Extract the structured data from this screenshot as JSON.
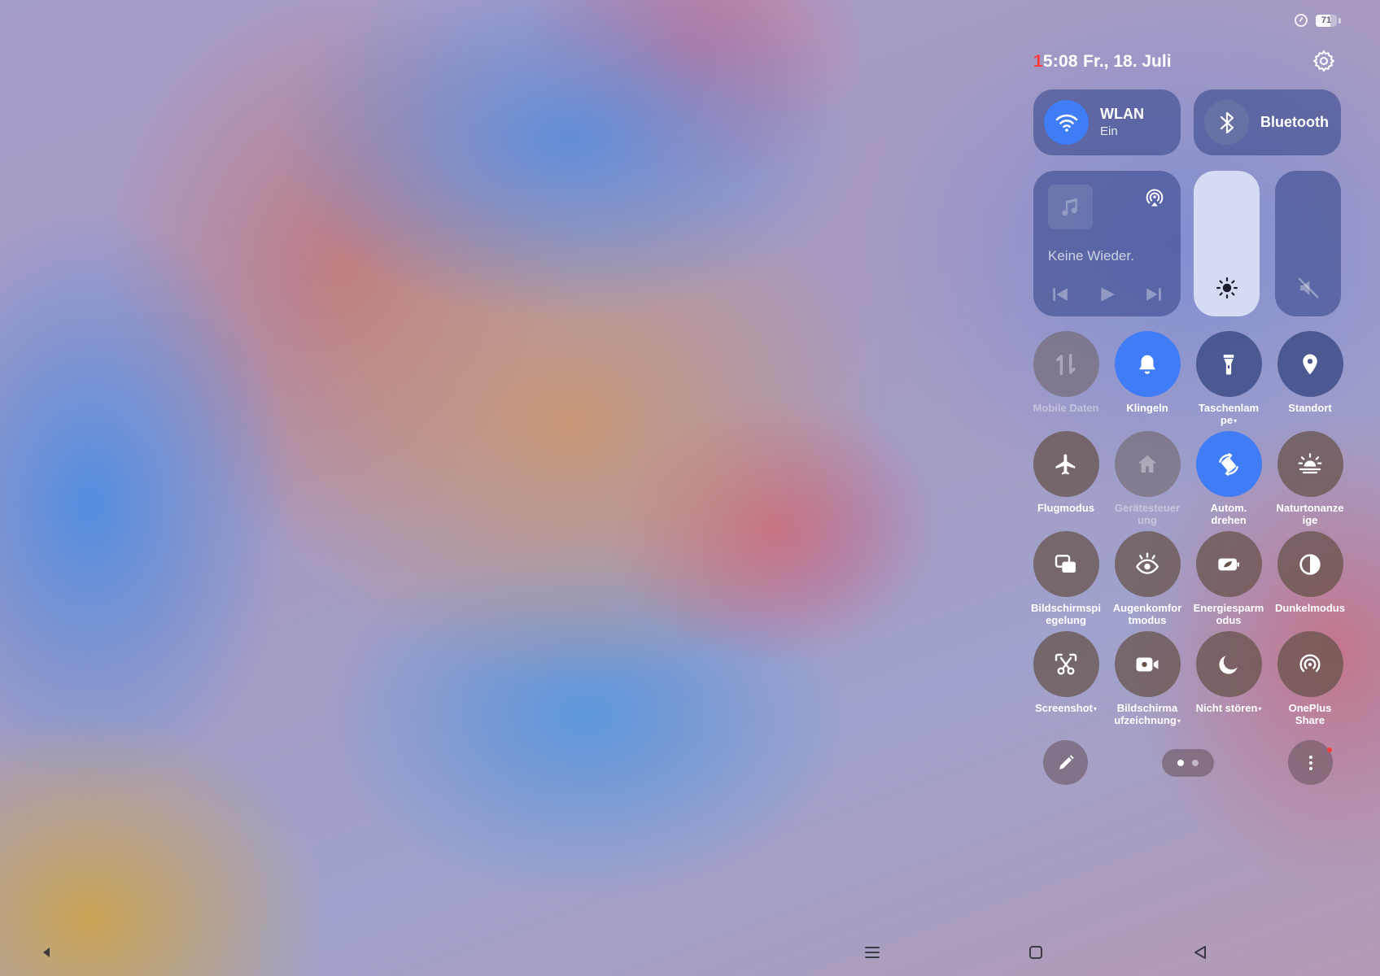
{
  "status_bar": {
    "battery": "71",
    "battery_level": 0.71
  },
  "header": {
    "time_first": "1",
    "time_rest": "5:08",
    "date": "Fr., 18. Juli"
  },
  "tiles": {
    "wifi": {
      "title": "WLAN",
      "status": "Ein",
      "icon": "wifi-icon"
    },
    "bluetooth": {
      "title": "Bluetooth",
      "icon": "bluetooth-icon"
    }
  },
  "media": {
    "title": "Keine Wieder.",
    "icons": [
      "music-note-icon",
      "cast-icon",
      "previous-icon",
      "play-icon",
      "next-icon"
    ]
  },
  "sliders": {
    "brightness": {
      "level": 1.0,
      "icon": "sun-icon"
    },
    "volume": {
      "level": 0.0,
      "icon": "mute-icon"
    }
  },
  "toggles": [
    {
      "label": "Mobile Daten",
      "icon": "mobile-data-icon",
      "state": "disabled"
    },
    {
      "label": "Klingeln",
      "icon": "bell-icon",
      "state": "on"
    },
    {
      "label": "Taschenlam\npe",
      "icon": "flashlight-icon",
      "state": "off",
      "has_menu": true
    },
    {
      "label": "Standort",
      "icon": "location-icon",
      "state": "off"
    },
    {
      "label": "Flugmodus",
      "icon": "airplane-icon",
      "state": "off"
    },
    {
      "label": "Gerätesteuer\nung",
      "icon": "home-icon",
      "state": "disabled"
    },
    {
      "label": "Autom.\ndrehen",
      "icon": "auto-rotate-icon",
      "state": "on"
    },
    {
      "label": "Naturtonanze\nige",
      "icon": "natural-tone-icon",
      "state": "off"
    },
    {
      "label": "Bildschirmspi\negelung",
      "icon": "screen-mirror-icon",
      "state": "off"
    },
    {
      "label": "Augenkomfor\ntmodus",
      "icon": "eye-icon",
      "state": "off"
    },
    {
      "label": "Energiesparm\nodus",
      "icon": "battery-saver-icon",
      "state": "off"
    },
    {
      "label": "Dunkelmodus",
      "icon": "dark-mode-icon",
      "state": "off"
    },
    {
      "label": "Screenshot",
      "icon": "scissors-icon",
      "state": "off",
      "has_menu": true
    },
    {
      "label": "Bildschirma\nufzeichnung",
      "icon": "video-camera-icon",
      "state": "off",
      "has_menu": true
    },
    {
      "label": "Nicht stören",
      "icon": "moon-icon",
      "state": "off",
      "has_menu": true
    },
    {
      "label": "OnePlus\nShare",
      "icon": "share-icon",
      "state": "off"
    }
  ],
  "controls": {
    "page_count": 2,
    "active_page": 1
  },
  "nav_bar": [
    "left-arrow-icon",
    "menu-icon",
    "home-square-icon",
    "back-triangle-icon"
  ],
  "colors": {
    "accent": "#3f7cf5",
    "notification_dot": "#ff3b3b"
  }
}
